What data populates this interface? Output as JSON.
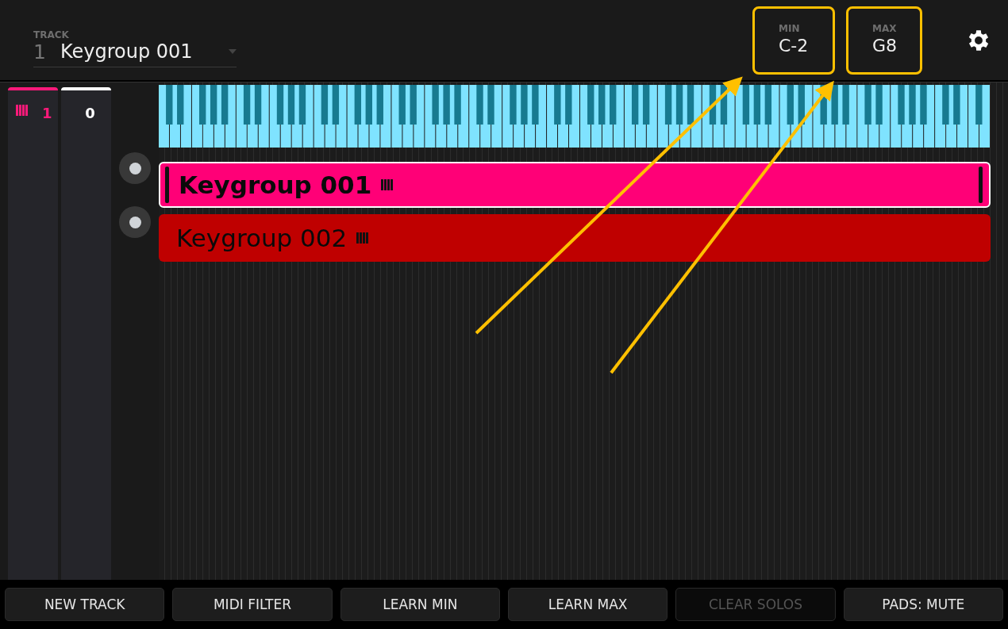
{
  "header": {
    "track_label": "TRACK",
    "track_number": "1",
    "track_name": "Keygroup 001",
    "ranges": [
      {
        "label": "MIN",
        "value": "C-2",
        "highlighted": true
      },
      {
        "label": "MAX",
        "value": "G8",
        "highlighted": true
      }
    ]
  },
  "strips": [
    {
      "value": "1",
      "color": "#ff1a7a",
      "kind": "keygroup"
    },
    {
      "value": "0",
      "color": "#ffffff",
      "kind": "plain"
    }
  ],
  "tracks": [
    {
      "name": "Keygroup 001",
      "color": "#ff0077",
      "selected": true
    },
    {
      "name": "Keygroup 002",
      "color": "#bf0000",
      "selected": false
    }
  ],
  "buttons": [
    {
      "label": "NEW TRACK",
      "disabled": false
    },
    {
      "label": "MIDI FILTER",
      "disabled": false
    },
    {
      "label": "LEARN MIN",
      "disabled": false
    },
    {
      "label": "LEARN MAX",
      "disabled": false
    },
    {
      "label": "CLEAR SOLOS",
      "disabled": true
    },
    {
      "label": "PADS: MUTE",
      "disabled": false
    }
  ]
}
